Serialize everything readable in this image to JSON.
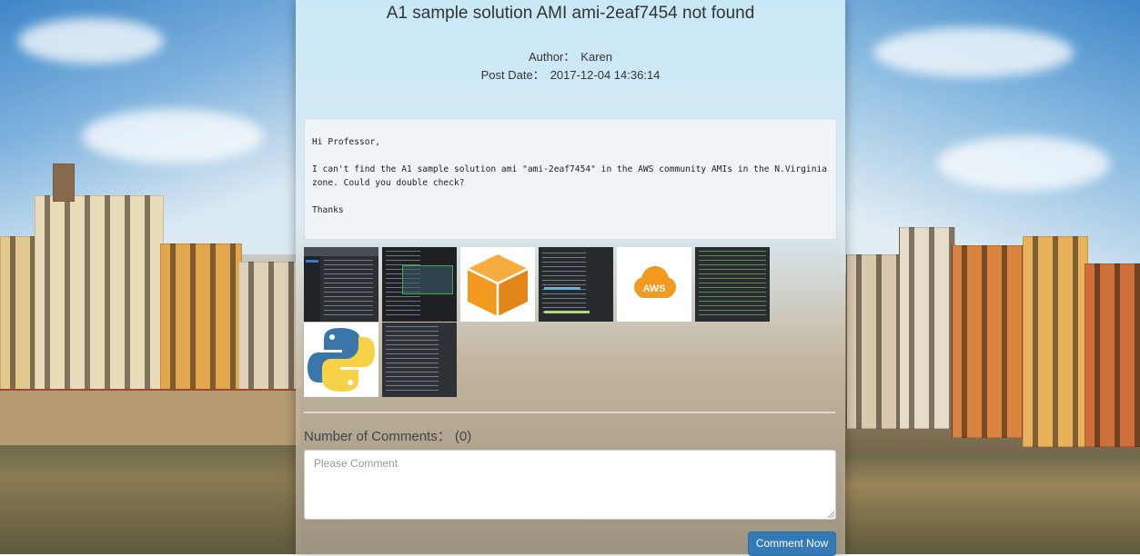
{
  "post": {
    "title": "A1 sample solution AMI ami-2eaf7454 not found",
    "author_label": "Author：",
    "author": "Karen",
    "date_label": "Post Date：",
    "date": "2017-12-04 14:36:14",
    "body": "Hi Professor,\n\nI can't find the A1 sample solution ami \"ami-2eaf7454\" in the AWS community AMIs in the N.Virginia zone. Could you double check?\n\nThanks"
  },
  "attachments": [
    {
      "icon": "screenshot-thumbnail"
    },
    {
      "icon": "terminal-screenshot-thumbnail"
    },
    {
      "icon": "aws-box-logo"
    },
    {
      "icon": "code-screenshot-thumbnail"
    },
    {
      "icon": "aws-cloud-logo",
      "text": "AWS"
    },
    {
      "icon": "code-screenshot-thumbnail"
    },
    {
      "icon": "python-logo"
    },
    {
      "icon": "terminal-screenshot-thumbnail"
    }
  ],
  "comments": {
    "label": "Number of Comments：",
    "count": "(0)",
    "placeholder": "Please Comment",
    "submit_label": "Comment Now"
  },
  "colors": {
    "accent": "#337ab7",
    "aws_orange": "#f29a1f"
  }
}
